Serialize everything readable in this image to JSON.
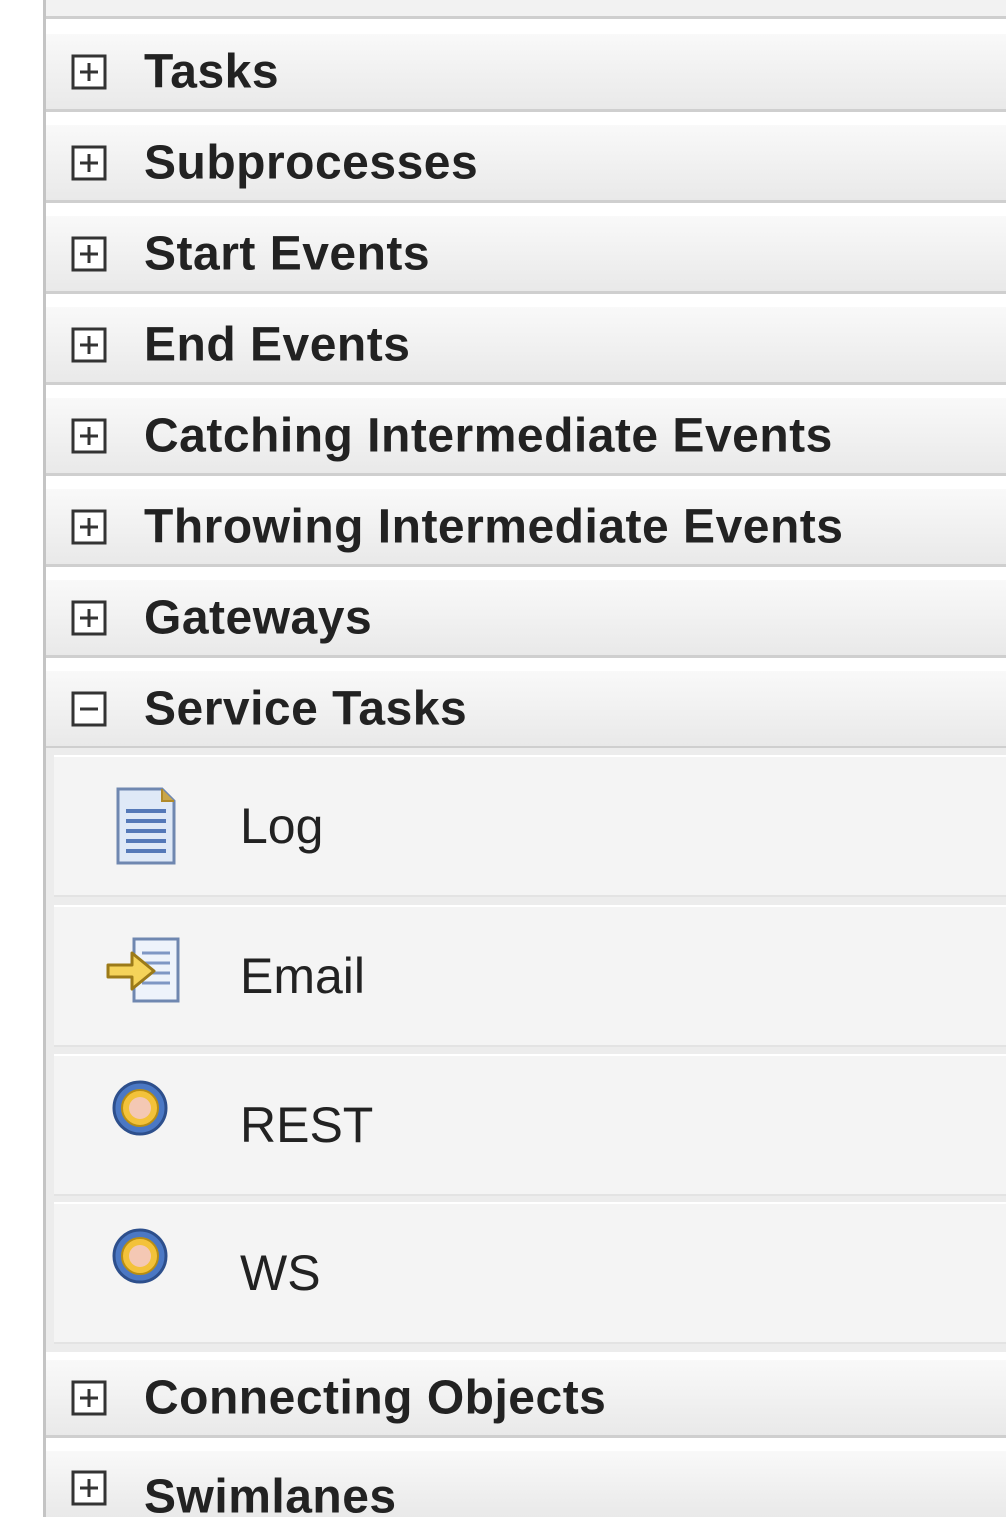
{
  "palette": {
    "drawers": [
      {
        "label": "Tasks",
        "state": "collapsed"
      },
      {
        "label": "Subprocesses",
        "state": "collapsed"
      },
      {
        "label": "Start Events",
        "state": "collapsed"
      },
      {
        "label": "End Events",
        "state": "collapsed"
      },
      {
        "label": "Catching Intermediate Events",
        "state": "collapsed"
      },
      {
        "label": "Throwing Intermediate Events",
        "state": "collapsed"
      },
      {
        "label": "Gateways",
        "state": "collapsed"
      },
      {
        "label": "Service Tasks",
        "state": "expanded"
      },
      {
        "label": "Connecting Objects",
        "state": "collapsed"
      },
      {
        "label": "Swimlanes",
        "state": "collapsed"
      }
    ],
    "service_tasks": [
      {
        "label": "Log",
        "icon": "log-document-icon"
      },
      {
        "label": "Email",
        "icon": "email-arrow-icon"
      },
      {
        "label": "REST",
        "icon": "service-gear-icon"
      },
      {
        "label": "WS",
        "icon": "service-gear-icon"
      }
    ]
  }
}
